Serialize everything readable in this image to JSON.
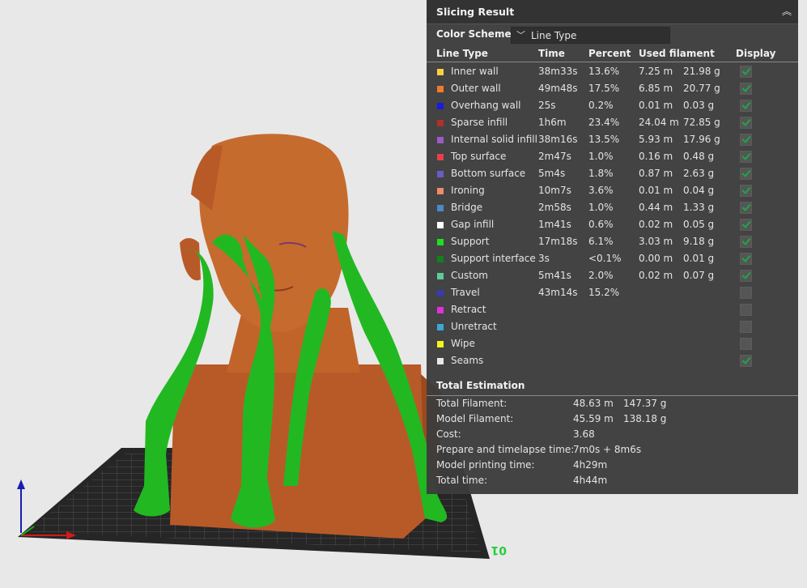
{
  "panel": {
    "title": "Slicing Result",
    "color_scheme_label": "Color Scheme",
    "color_scheme_value": "Line Type",
    "columns": [
      "Line Type",
      "Time",
      "Percent",
      "Used filament",
      "Display"
    ],
    "rows": [
      {
        "name": "Inner wall",
        "time": "38m33s",
        "percent": "13.6%",
        "length": "7.25 m",
        "weight": "21.98 g",
        "color": "#f5d142",
        "display": true
      },
      {
        "name": "Outer wall",
        "time": "49m48s",
        "percent": "17.5%",
        "length": "6.85 m",
        "weight": "20.77 g",
        "color": "#f07b2e",
        "display": true
      },
      {
        "name": "Overhang wall",
        "time": "25s",
        "percent": "0.2%",
        "length": "0.01 m",
        "weight": "0.03 g",
        "color": "#1a1ae0",
        "display": true
      },
      {
        "name": "Sparse infill",
        "time": "1h6m",
        "percent": "23.4%",
        "length": "24.04 m",
        "weight": "72.85 g",
        "color": "#b0302a",
        "display": true
      },
      {
        "name": "Internal solid infill",
        "time": "38m16s",
        "percent": "13.5%",
        "length": "5.93 m",
        "weight": "17.96 g",
        "color": "#9a5cc8",
        "display": true
      },
      {
        "name": "Top surface",
        "time": "2m47s",
        "percent": "1.0%",
        "length": "0.16 m",
        "weight": "0.48 g",
        "color": "#e8404a",
        "display": true
      },
      {
        "name": "Bottom surface",
        "time": "5m4s",
        "percent": "1.8%",
        "length": "0.87 m",
        "weight": "2.63 g",
        "color": "#6a5cc8",
        "display": true
      },
      {
        "name": "Ironing",
        "time": "10m7s",
        "percent": "3.6%",
        "length": "0.01 m",
        "weight": "0.04 g",
        "color": "#f08a6a",
        "display": true
      },
      {
        "name": "Bridge",
        "time": "2m58s",
        "percent": "1.0%",
        "length": "0.44 m",
        "weight": "1.33 g",
        "color": "#4a8ac8",
        "display": true
      },
      {
        "name": "Gap infill",
        "time": "1m41s",
        "percent": "0.6%",
        "length": "0.02 m",
        "weight": "0.05 g",
        "color": "#ffffff",
        "display": true
      },
      {
        "name": "Support",
        "time": "17m18s",
        "percent": "6.1%",
        "length": "3.03 m",
        "weight": "9.18 g",
        "color": "#1fe01f",
        "display": true
      },
      {
        "name": "Support interface",
        "time": "3s",
        "percent": "<0.1%",
        "length": "0.00 m",
        "weight": "0.01 g",
        "color": "#14801e",
        "display": true
      },
      {
        "name": "Custom",
        "time": "5m41s",
        "percent": "2.0%",
        "length": "0.02 m",
        "weight": "0.07 g",
        "color": "#5ecc9a",
        "display": true
      },
      {
        "name": "Travel",
        "time": "43m14s",
        "percent": "15.2%",
        "length": "",
        "weight": "",
        "color": "#3a3ab0",
        "display": false
      },
      {
        "name": "Retract",
        "time": "",
        "percent": "",
        "length": "",
        "weight": "",
        "color": "#e030e0",
        "display": false
      },
      {
        "name": "Unretract",
        "time": "",
        "percent": "",
        "length": "",
        "weight": "",
        "color": "#3aa8d8",
        "display": false
      },
      {
        "name": "Wipe",
        "time": "",
        "percent": "",
        "length": "",
        "weight": "",
        "color": "#f5f51a",
        "display": false
      },
      {
        "name": "Seams",
        "time": "",
        "percent": "",
        "length": "",
        "weight": "",
        "color": "#e8e8e8",
        "display": true
      }
    ],
    "total_title": "Total Estimation",
    "totals": [
      {
        "label": "Total Filament:",
        "v1": "48.63 m",
        "v2": "147.37 g"
      },
      {
        "label": "Model Filament:",
        "v1": "45.59 m",
        "v2": "138.18 g"
      },
      {
        "label": "Cost:",
        "v1": "3.68",
        "v2": ""
      },
      {
        "label": "Prepare and timelapse time:",
        "v1": "7m0s + 8m6s",
        "v2": ""
      },
      {
        "label": "Model printing time:",
        "v1": "4h29m",
        "v2": ""
      },
      {
        "label": "Total time:",
        "v1": "4h44m",
        "v2": ""
      }
    ]
  },
  "viewport": {
    "plate_label": "01",
    "colors": {
      "model": "#c0642a",
      "support": "#22b822",
      "plate": "#262626",
      "axis_x": "#d21a1a",
      "axis_y": "#1aa81a",
      "axis_z": "#1a1ab4",
      "background": "#e8e8e8"
    }
  }
}
